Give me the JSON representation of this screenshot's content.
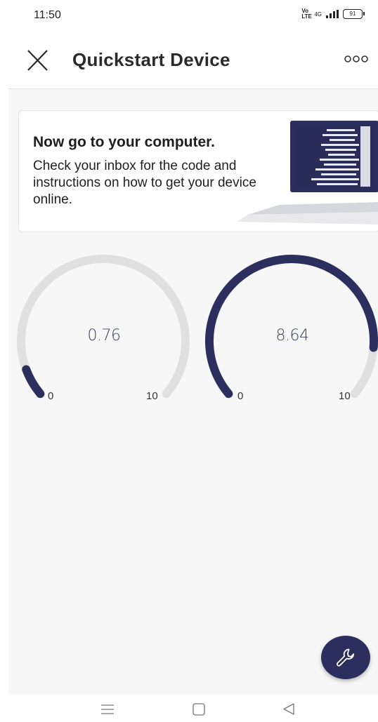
{
  "status_bar": {
    "time": "11:50",
    "volte_label": "Vo LTE",
    "network_label": "4G",
    "battery_level": "91"
  },
  "app_bar": {
    "title": "Quickstart Device",
    "close_icon": "close-icon",
    "more_icon": "more-options-icon"
  },
  "card": {
    "title": "Now go to your computer.",
    "body": "Check your inbox for the code and instructions on how to get your device online.",
    "illustration": "laptop-illustration"
  },
  "gauges": [
    {
      "value": 0.76,
      "value_label": "0.76",
      "min_label": "0",
      "max_label": "10",
      "min": 0,
      "max": 10
    },
    {
      "value": 8.64,
      "value_label": "8.64",
      "min_label": "0",
      "max_label": "10",
      "min": 0,
      "max": 10
    }
  ],
  "fab": {
    "icon": "wrench-icon"
  },
  "nav_bar": {
    "menu_icon": "menu-icon",
    "home_icon": "home-icon",
    "back_icon": "back-icon"
  },
  "colors": {
    "accent": "#2c2f5e",
    "gauge_track": "#e0e0e0",
    "background": "#f7f7f7"
  }
}
